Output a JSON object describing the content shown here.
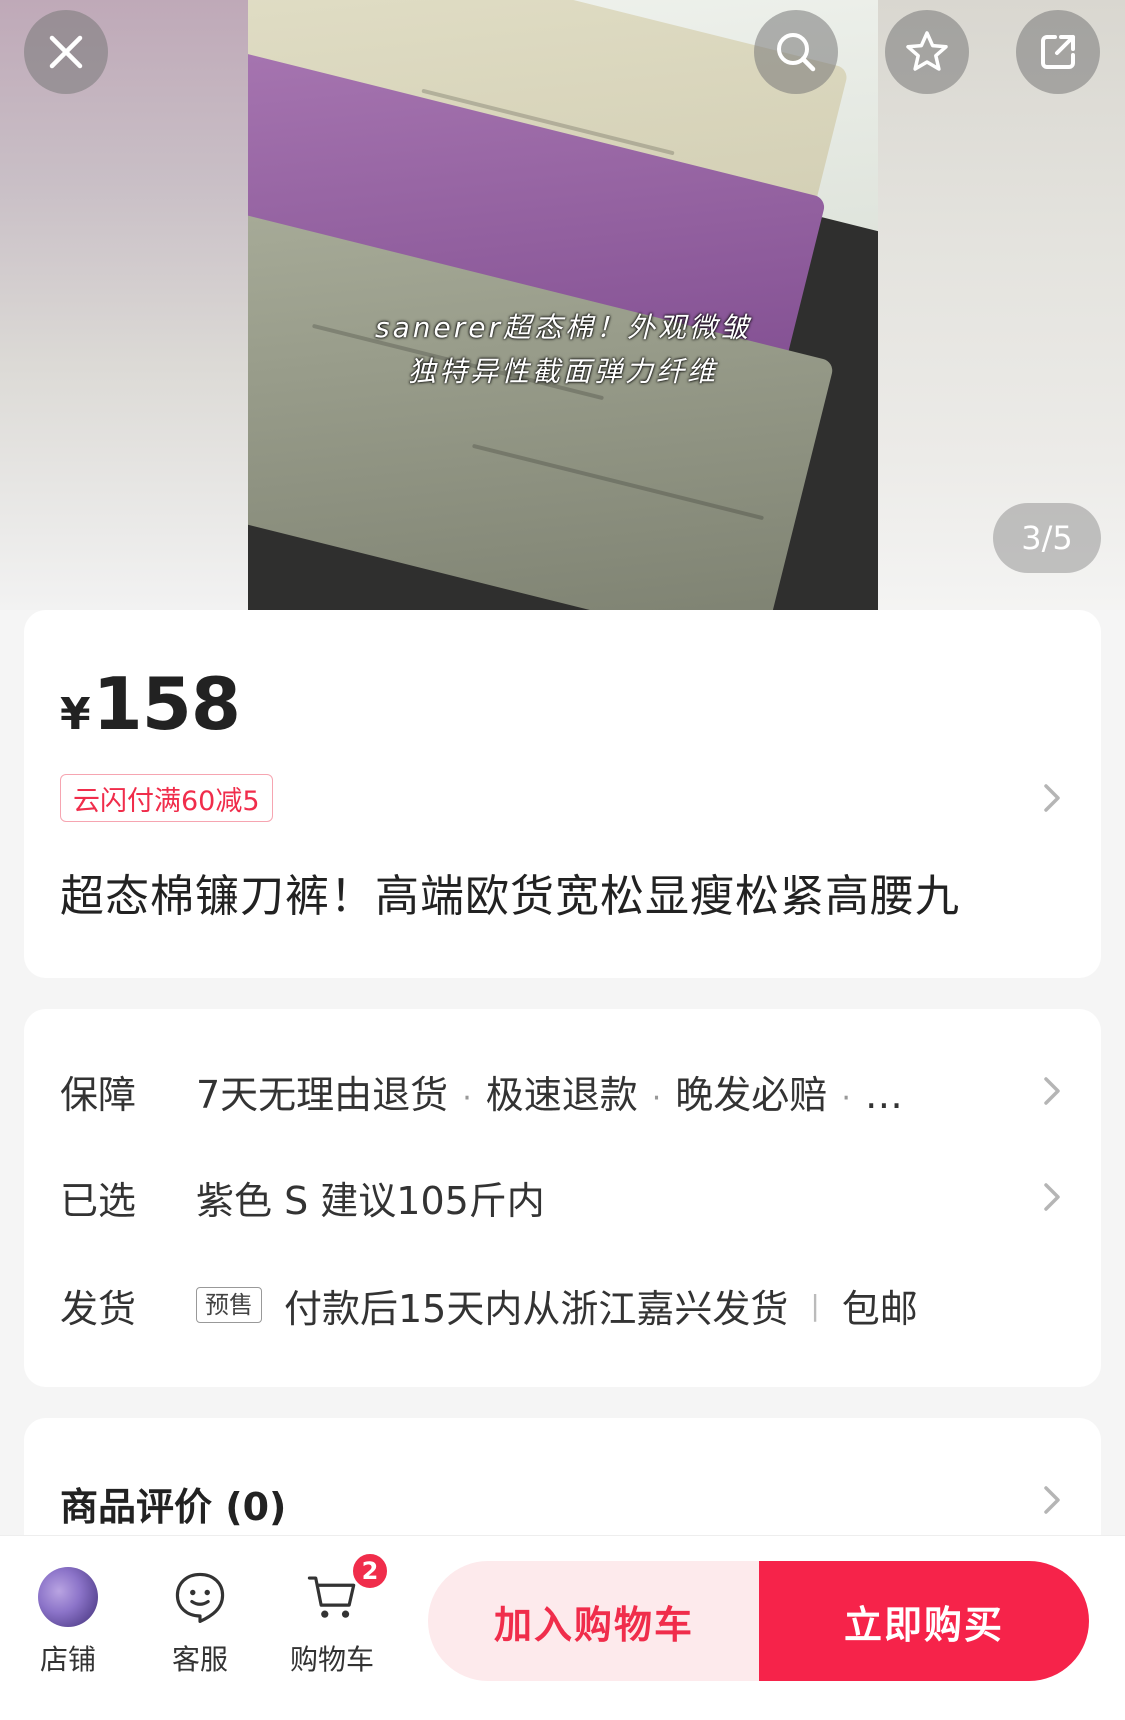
{
  "gallery": {
    "caption_line1": "sanerer超态棉！外观微皱",
    "caption_line2": "独特异性截面弹力纤维",
    "page_indicator": "3/5",
    "buttons": {
      "close": "close-icon",
      "search": "search-icon",
      "favorite": "star-icon",
      "share": "share-icon"
    }
  },
  "product": {
    "currency_symbol": "¥",
    "price": "158",
    "promo": "云闪付满60减5",
    "title": "超态棉镰刀裤！高端欧货宽松显瘦松紧高腰九"
  },
  "info": {
    "guarantee_label": "保障",
    "guarantee_items": [
      "7天无理由退货",
      "极速退款",
      "晚发必赔",
      "…"
    ],
    "selected_label": "已选",
    "selected_value": "紫色 S 建议105斤内",
    "shipping_label": "发货",
    "presale_tag": "预售",
    "shipping_value": "付款后15天内从浙江嘉兴发货",
    "free_shipping": "包邮"
  },
  "reviews": {
    "title": "商品评价 (0)"
  },
  "bottom_bar": {
    "store_label": "店铺",
    "service_label": "客服",
    "cart_label": "购物车",
    "cart_count": "2",
    "add_to_cart": "加入购物车",
    "buy_now": "立即购买"
  },
  "colors": {
    "accent": "#f6234a",
    "accent_light": "#fdeaec",
    "promo_border": "#f6a5b1"
  }
}
